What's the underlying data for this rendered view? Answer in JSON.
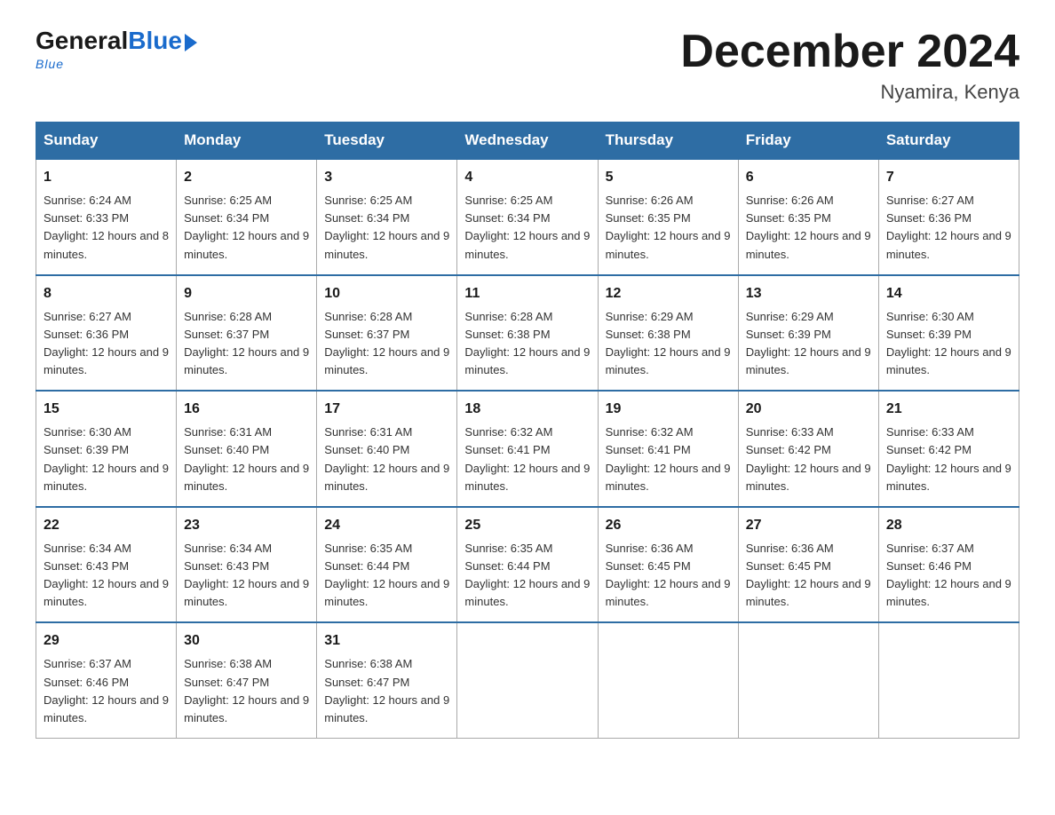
{
  "header": {
    "logo_general": "General",
    "logo_blue": "Blue",
    "logo_tagline": "Blue",
    "title": "December 2024",
    "location": "Nyamira, Kenya"
  },
  "days_of_week": [
    "Sunday",
    "Monday",
    "Tuesday",
    "Wednesday",
    "Thursday",
    "Friday",
    "Saturday"
  ],
  "weeks": [
    [
      {
        "day": "1",
        "sunrise": "6:24 AM",
        "sunset": "6:33 PM",
        "daylight": "12 hours and 8 minutes."
      },
      {
        "day": "2",
        "sunrise": "6:25 AM",
        "sunset": "6:34 PM",
        "daylight": "12 hours and 9 minutes."
      },
      {
        "day": "3",
        "sunrise": "6:25 AM",
        "sunset": "6:34 PM",
        "daylight": "12 hours and 9 minutes."
      },
      {
        "day": "4",
        "sunrise": "6:25 AM",
        "sunset": "6:34 PM",
        "daylight": "12 hours and 9 minutes."
      },
      {
        "day": "5",
        "sunrise": "6:26 AM",
        "sunset": "6:35 PM",
        "daylight": "12 hours and 9 minutes."
      },
      {
        "day": "6",
        "sunrise": "6:26 AM",
        "sunset": "6:35 PM",
        "daylight": "12 hours and 9 minutes."
      },
      {
        "day": "7",
        "sunrise": "6:27 AM",
        "sunset": "6:36 PM",
        "daylight": "12 hours and 9 minutes."
      }
    ],
    [
      {
        "day": "8",
        "sunrise": "6:27 AM",
        "sunset": "6:36 PM",
        "daylight": "12 hours and 9 minutes."
      },
      {
        "day": "9",
        "sunrise": "6:28 AM",
        "sunset": "6:37 PM",
        "daylight": "12 hours and 9 minutes."
      },
      {
        "day": "10",
        "sunrise": "6:28 AM",
        "sunset": "6:37 PM",
        "daylight": "12 hours and 9 minutes."
      },
      {
        "day": "11",
        "sunrise": "6:28 AM",
        "sunset": "6:38 PM",
        "daylight": "12 hours and 9 minutes."
      },
      {
        "day": "12",
        "sunrise": "6:29 AM",
        "sunset": "6:38 PM",
        "daylight": "12 hours and 9 minutes."
      },
      {
        "day": "13",
        "sunrise": "6:29 AM",
        "sunset": "6:39 PM",
        "daylight": "12 hours and 9 minutes."
      },
      {
        "day": "14",
        "sunrise": "6:30 AM",
        "sunset": "6:39 PM",
        "daylight": "12 hours and 9 minutes."
      }
    ],
    [
      {
        "day": "15",
        "sunrise": "6:30 AM",
        "sunset": "6:39 PM",
        "daylight": "12 hours and 9 minutes."
      },
      {
        "day": "16",
        "sunrise": "6:31 AM",
        "sunset": "6:40 PM",
        "daylight": "12 hours and 9 minutes."
      },
      {
        "day": "17",
        "sunrise": "6:31 AM",
        "sunset": "6:40 PM",
        "daylight": "12 hours and 9 minutes."
      },
      {
        "day": "18",
        "sunrise": "6:32 AM",
        "sunset": "6:41 PM",
        "daylight": "12 hours and 9 minutes."
      },
      {
        "day": "19",
        "sunrise": "6:32 AM",
        "sunset": "6:41 PM",
        "daylight": "12 hours and 9 minutes."
      },
      {
        "day": "20",
        "sunrise": "6:33 AM",
        "sunset": "6:42 PM",
        "daylight": "12 hours and 9 minutes."
      },
      {
        "day": "21",
        "sunrise": "6:33 AM",
        "sunset": "6:42 PM",
        "daylight": "12 hours and 9 minutes."
      }
    ],
    [
      {
        "day": "22",
        "sunrise": "6:34 AM",
        "sunset": "6:43 PM",
        "daylight": "12 hours and 9 minutes."
      },
      {
        "day": "23",
        "sunrise": "6:34 AM",
        "sunset": "6:43 PM",
        "daylight": "12 hours and 9 minutes."
      },
      {
        "day": "24",
        "sunrise": "6:35 AM",
        "sunset": "6:44 PM",
        "daylight": "12 hours and 9 minutes."
      },
      {
        "day": "25",
        "sunrise": "6:35 AM",
        "sunset": "6:44 PM",
        "daylight": "12 hours and 9 minutes."
      },
      {
        "day": "26",
        "sunrise": "6:36 AM",
        "sunset": "6:45 PM",
        "daylight": "12 hours and 9 minutes."
      },
      {
        "day": "27",
        "sunrise": "6:36 AM",
        "sunset": "6:45 PM",
        "daylight": "12 hours and 9 minutes."
      },
      {
        "day": "28",
        "sunrise": "6:37 AM",
        "sunset": "6:46 PM",
        "daylight": "12 hours and 9 minutes."
      }
    ],
    [
      {
        "day": "29",
        "sunrise": "6:37 AM",
        "sunset": "6:46 PM",
        "daylight": "12 hours and 9 minutes."
      },
      {
        "day": "30",
        "sunrise": "6:38 AM",
        "sunset": "6:47 PM",
        "daylight": "12 hours and 9 minutes."
      },
      {
        "day": "31",
        "sunrise": "6:38 AM",
        "sunset": "6:47 PM",
        "daylight": "12 hours and 9 minutes."
      },
      null,
      null,
      null,
      null
    ]
  ],
  "labels": {
    "sunrise": "Sunrise:",
    "sunset": "Sunset:",
    "daylight": "Daylight:"
  }
}
